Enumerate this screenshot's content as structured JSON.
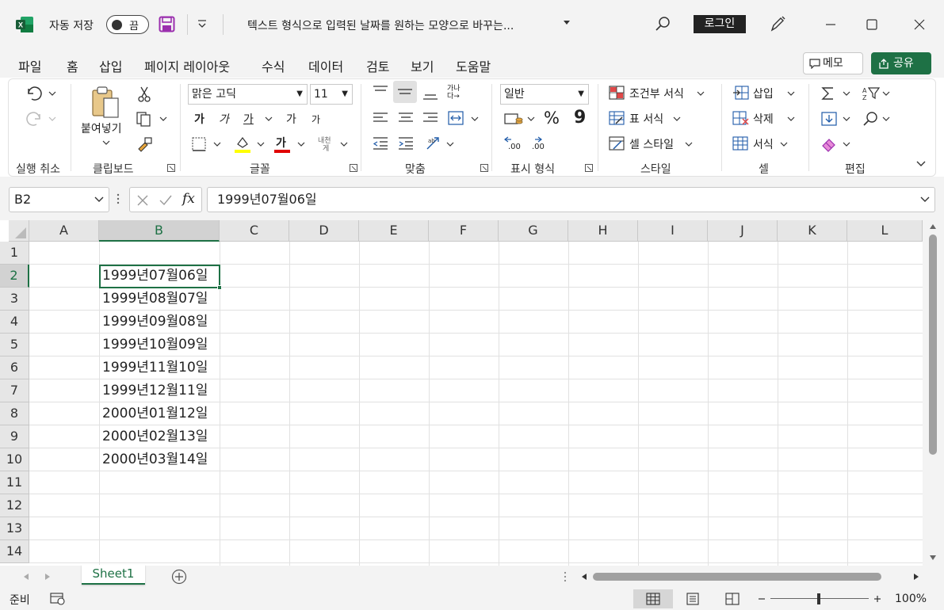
{
  "titlebar": {
    "autosave_label": "자동 저장",
    "autosave_state": "끔",
    "document_title": "텍스트 형식으로 입력된 날짜를 원하는 모양으로 바꾸는...",
    "signin_label": "로그인"
  },
  "menu": {
    "items": [
      "파일",
      "홈",
      "삽입",
      "페이지 레이아웃",
      "수식",
      "데이터",
      "검토",
      "보기",
      "도움말"
    ],
    "active": "홈",
    "memo_label": "메모",
    "share_label": "공유"
  },
  "ribbon": {
    "groups": {
      "undo": "실행 취소",
      "clipboard": "클립보드",
      "font": "글꼴",
      "alignment": "맞춤",
      "number": "표시 형식",
      "styles": "스타일",
      "cells": "셀",
      "editing": "편집"
    },
    "paste_label": "붙여넣기",
    "font_name": "맑은 고딕",
    "font_size": "11",
    "number_format": "일반",
    "conditional_format": "조건부 서식",
    "format_as_table": "표 서식",
    "cell_styles": "셀 스타일",
    "insert": "삽입",
    "delete": "삭제",
    "format": "서식",
    "bold": "가",
    "italic": "가",
    "underline": "가",
    "grow_font": "가",
    "shrink_font": "가",
    "font_color_glyph": "가",
    "phonetic_top": "내천",
    "phonetic_bottom": "게",
    "wrap_top": "가나",
    "wrap_bottom": "다→",
    "percent": "%",
    "comma": "9",
    "dec_inc": ".00",
    "dec_dec": ".00"
  },
  "formula_bar": {
    "name_box": "B2",
    "fx": "fx",
    "formula": "1999년07월06일"
  },
  "grid": {
    "columns": [
      "A",
      "B",
      "C",
      "D",
      "E",
      "F",
      "G",
      "H",
      "I",
      "J",
      "K",
      "L"
    ],
    "selected_column": "B",
    "rows": [
      "1",
      "2",
      "3",
      "4",
      "5",
      "6",
      "7",
      "8",
      "9",
      "10",
      "11",
      "12",
      "13",
      "14"
    ],
    "selected_row": "2",
    "b_values": [
      "",
      "1999년07월06일",
      "1999년08월07일",
      "1999년09월08일",
      "1999년10월09일",
      "1999년11월10일",
      "1999년12월11일",
      "2000년01월12일",
      "2000년02월13일",
      "2000년03월14일",
      "",
      "",
      "",
      ""
    ]
  },
  "sheets": {
    "tabs": [
      "Sheet1"
    ],
    "active": "Sheet1"
  },
  "status": {
    "ready": "준비",
    "zoom": "100%"
  },
  "colors": {
    "accent": "#1e7145",
    "chrome": "#f3f3f3"
  }
}
